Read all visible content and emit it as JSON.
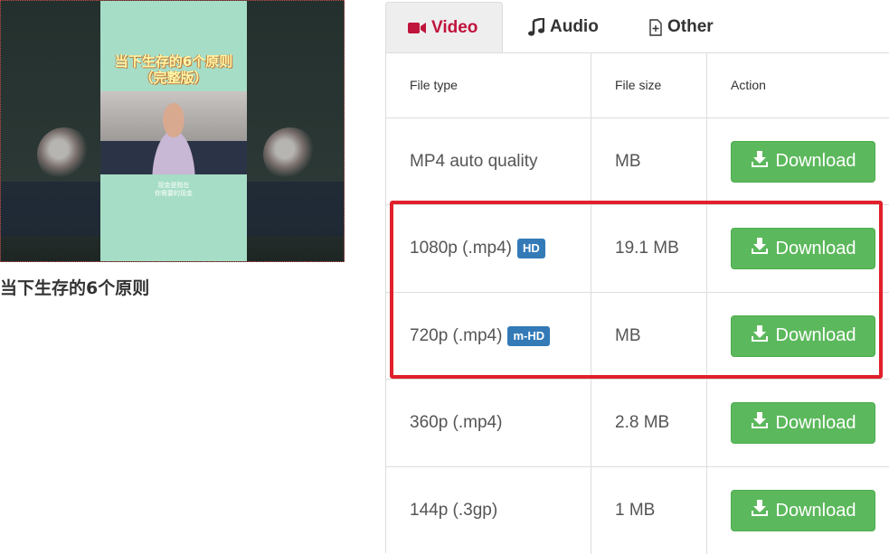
{
  "video": {
    "title": "当下生存的6个原则",
    "thumbnail_title_line1": "当下生存的6个原则",
    "thumbnail_title_line2": "（完整版）",
    "thumbnail_caption_line1": "现金是指在",
    "thumbnail_caption_line2": "你需要的现金"
  },
  "tabs": [
    {
      "label": "Video",
      "icon": "video-camera-icon",
      "active": true
    },
    {
      "label": "Audio",
      "icon": "music-note-icon",
      "active": false
    },
    {
      "label": "Other",
      "icon": "file-plus-icon",
      "active": false
    }
  ],
  "table": {
    "headers": {
      "file_type": "File type",
      "file_size": "File size",
      "action": "Action"
    },
    "rows": [
      {
        "file_type": "MP4 auto quality",
        "badge": "",
        "file_size": "MB",
        "action": "Download"
      },
      {
        "file_type": "1080p (.mp4)",
        "badge": "HD",
        "file_size": "19.1 MB",
        "action": "Download"
      },
      {
        "file_type": "720p (.mp4)",
        "badge": "m-HD",
        "file_size": "MB",
        "action": "Download"
      },
      {
        "file_type": "360p (.mp4)",
        "badge": "",
        "file_size": "2.8 MB",
        "action": "Download"
      },
      {
        "file_type": "144p (.3gp)",
        "badge": "",
        "file_size": "1 MB",
        "action": "Download"
      }
    ]
  },
  "colors": {
    "active_tab_text": "#c0143c",
    "download_button": "#5cb85c",
    "badge": "#337ab7",
    "highlight_box": "#e0202a"
  }
}
